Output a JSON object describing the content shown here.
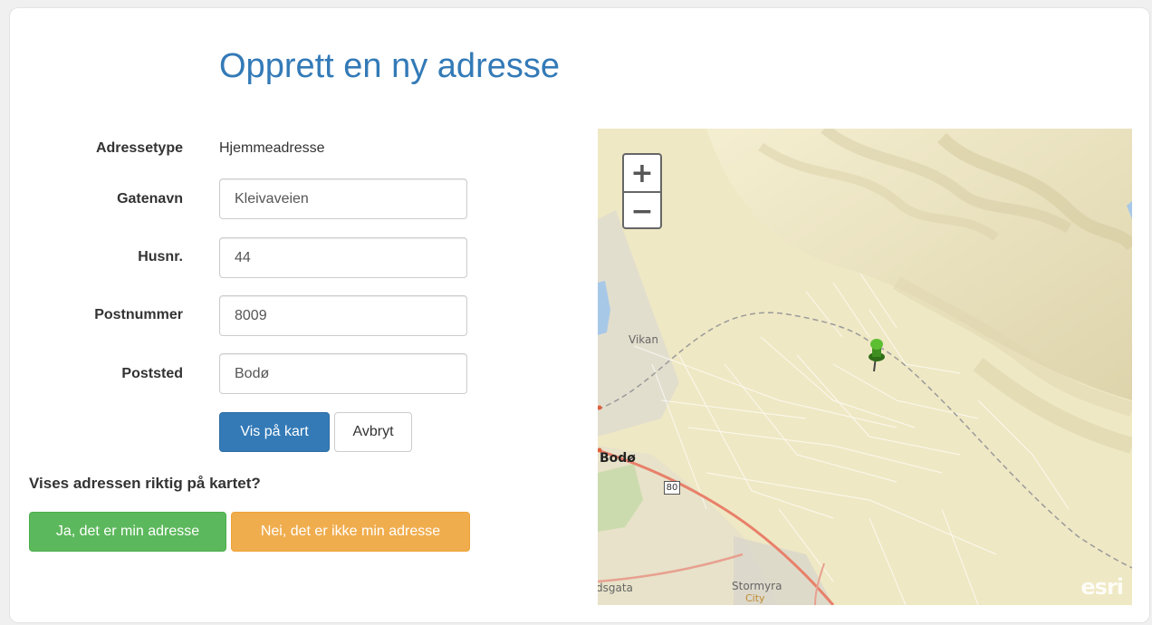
{
  "page": {
    "title": "Opprett en ny adresse"
  },
  "form": {
    "address_type": {
      "label": "Adressetype",
      "value": "Hjemmeadresse"
    },
    "street": {
      "label": "Gatenavn",
      "value": "Kleivaveien"
    },
    "house_number": {
      "label": "Husnr.",
      "value": "44"
    },
    "postal_code": {
      "label": "Postnummer",
      "value": "8009"
    },
    "city": {
      "label": "Poststed",
      "value": "Bodø"
    },
    "show_on_map_label": "Vis på kart",
    "cancel_label": "Avbryt"
  },
  "confirm": {
    "question": "Vises adressen riktig på kartet?",
    "yes_label": "Ja, det er min adresse",
    "no_label": "Nei, det er ikke min adresse"
  },
  "map": {
    "zoom_in": "+",
    "zoom_out": "−",
    "labels": {
      "vikan": "Vikan",
      "bodo": "Bodø",
      "road_number": "80",
      "street_fragment": "dsgata",
      "stormyra": "Stormyra",
      "city": "City"
    },
    "attribution": "esri",
    "marker_icon": "pushpin-icon",
    "colors": {
      "land": "#efe8c4",
      "road_major": "#e8806a",
      "railway": "#999999",
      "marker": "#4caf28"
    }
  },
  "colors": {
    "title": "#337ab7",
    "primary": "#337ab7",
    "success": "#5cb85c",
    "warning": "#f0ad4e"
  }
}
